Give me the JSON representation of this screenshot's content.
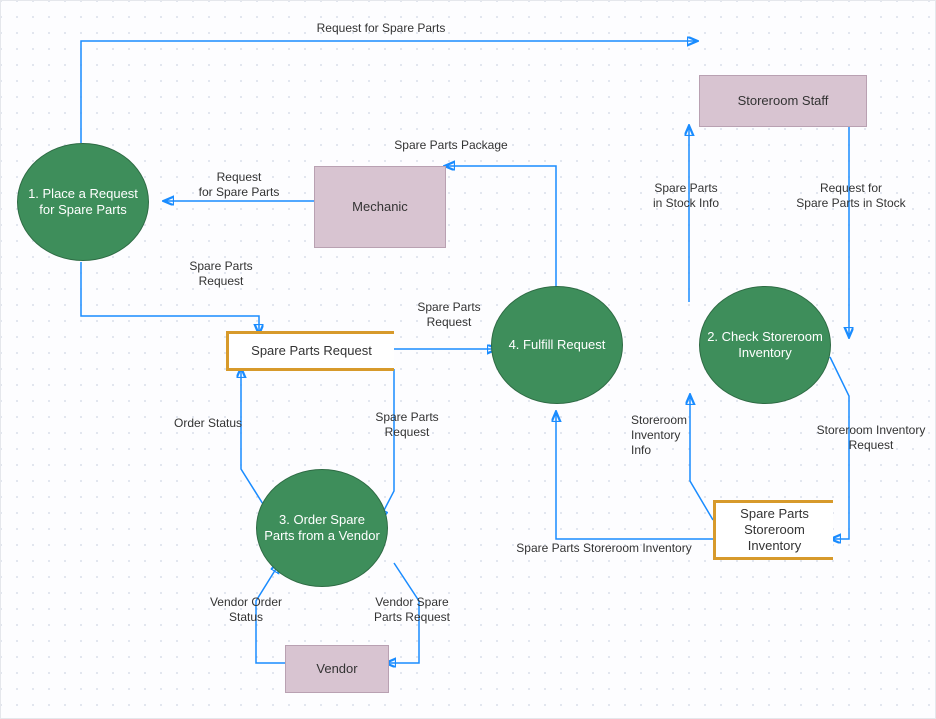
{
  "nodes": {
    "p1": "1. Place a Request for Spare Parts",
    "p2": "2. Check Storeroom Inventory",
    "p3": "3. Order Spare Parts from a Vendor",
    "p4": "4. Fulfill Request",
    "mechanic": "Mechanic",
    "storeroom_staff": "Storeroom Staff",
    "vendor": "Vendor",
    "ds_request": "Spare Parts Request",
    "ds_inventory": "Spare Parts Storeroom Inventory"
  },
  "labels": {
    "req_top": "Request for Spare Parts",
    "req_mech_p1_a": "Request",
    "req_mech_p1_b": "for Spare Parts",
    "spare_package": "Spare Parts Package",
    "p1_to_ds_a": "Spare Parts",
    "p1_to_ds_b": "Request",
    "ds_to_p4_a": "Spare Parts",
    "ds_to_p4_b": "Request",
    "ds_to_p3_a": "Spare Parts",
    "ds_to_p3_b": "Request",
    "order_status": "Order Status",
    "vendor_req_a": "Vendor Spare",
    "vendor_req_b": "Parts Request",
    "vendor_status_a": "Vendor Order",
    "vendor_status_b": "Status",
    "storeroom_info_a": "Storeroom",
    "storeroom_info_b": "Inventory",
    "storeroom_info_c": "Info",
    "inv_label": "Spare Parts Storeroom Inventory",
    "instock_info_a": "Spare Parts",
    "instock_info_b": "in Stock Info",
    "req_stock_a": "Request for",
    "req_stock_b": "Spare Parts in Stock",
    "inv_req_a": "Storeroom Inventory",
    "inv_req_b": "Request"
  }
}
